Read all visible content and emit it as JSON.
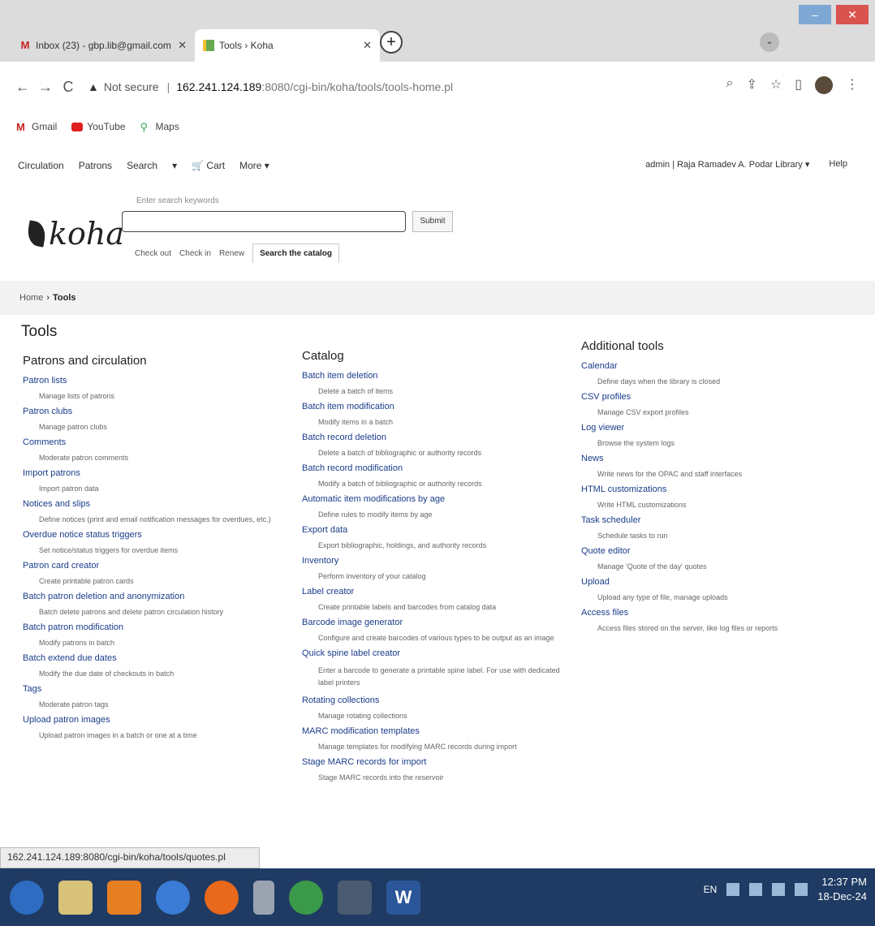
{
  "browser": {
    "tabs": [
      {
        "title": "Inbox (23) - gbp.lib@gmail.com"
      },
      {
        "title": "Tools › Koha"
      }
    ],
    "url": {
      "security": "Not secure",
      "host": "162.241.124.189",
      "path": ":8080/cgi-bin/koha/tools/tools-home.pl"
    },
    "bookmarks": [
      "Gmail",
      "YouTube",
      "Maps"
    ]
  },
  "koha": {
    "nav": [
      "Circulation",
      "Patrons",
      "Search",
      "▾",
      "🛒 Cart",
      "More ▾"
    ],
    "user": "admin | Raja Ramadev A. Podar Library ▾",
    "help": "Help",
    "logo": "koha",
    "search": {
      "hint": "Enter search keywords",
      "placeholder": "",
      "submit": "Submit",
      "tabs": [
        "Check out",
        "Check in",
        "Renew",
        "Search the catalog"
      ]
    },
    "breadcrumb": {
      "home": "Home",
      "current": "Tools"
    },
    "title": "Tools",
    "columns": [
      {
        "heading": "Patrons and circulation",
        "items": [
          {
            "link": "Patron lists",
            "desc": "Manage lists of patrons"
          },
          {
            "link": "Patron clubs",
            "desc": "Manage patron clubs"
          },
          {
            "link": "Comments",
            "desc": "Moderate patron comments"
          },
          {
            "link": "Import patrons",
            "desc": "Import patron data"
          },
          {
            "link": "Notices and slips",
            "desc": "Define notices (print and email notification messages for overdues, etc.)"
          },
          {
            "link": "Overdue notice status triggers",
            "desc": "Set notice/status triggers for overdue items"
          },
          {
            "link": "Patron card creator",
            "desc": "Create printable patron cards"
          },
          {
            "link": "Batch patron deletion and anonymization",
            "desc": "Batch delete patrons and delete patron circulation history"
          },
          {
            "link": "Batch patron modification",
            "desc": "Modify patrons in batch"
          },
          {
            "link": "Batch extend due dates",
            "desc": "Modify the due date of checkouts in batch"
          },
          {
            "link": "Tags",
            "desc": "Moderate patron tags"
          },
          {
            "link": "Upload patron images",
            "desc": "Upload patron images in a batch or one at a time"
          }
        ]
      },
      {
        "heading": "Catalog",
        "items": [
          {
            "link": "Batch item deletion",
            "desc": "Delete a batch of items"
          },
          {
            "link": "Batch item modification",
            "desc": "Modify items in a batch"
          },
          {
            "link": "Batch record deletion",
            "desc": "Delete a batch of bibliographic or authority records"
          },
          {
            "link": "Batch record modification",
            "desc": "Modify a batch of bibliographic or authority records"
          },
          {
            "link": "Automatic item modifications by age",
            "desc": "Define rules to modify items by age"
          },
          {
            "link": "Export data",
            "desc": "Export bibliographic, holdings, and authority records"
          },
          {
            "link": "Inventory",
            "desc": "Perform inventory of your catalog"
          },
          {
            "link": "Label creator",
            "desc": "Create printable labels and barcodes from catalog data"
          },
          {
            "link": "Barcode image generator",
            "desc": "Configure and create barcodes of various types to be output as an image"
          },
          {
            "link": "Quick spine label creator",
            "desc": "Enter a barcode to generate a printable spine label. For use with dedicated label printers"
          },
          {
            "link": "Rotating collections",
            "desc": "Manage rotating collections"
          },
          {
            "link": "MARC modification templates",
            "desc": "Manage templates for modifying MARC records during import"
          },
          {
            "link": "Stage MARC records for import",
            "desc": "Stage MARC records into the reservoir"
          }
        ]
      },
      {
        "heading": "Additional tools",
        "items": [
          {
            "link": "Calendar",
            "desc": "Define days when the library is closed"
          },
          {
            "link": "CSV profiles",
            "desc": "Manage CSV export profiles"
          },
          {
            "link": "Log viewer",
            "desc": "Browse the system logs"
          },
          {
            "link": "News",
            "desc": "Write news for the OPAC and staff interfaces"
          },
          {
            "link": "HTML customizations",
            "desc": "Write HTML customizations"
          },
          {
            "link": "Task scheduler",
            "desc": "Schedule tasks to run"
          },
          {
            "link": "Quote editor",
            "desc": "Manage 'Quote of the day' quotes"
          },
          {
            "link": "Upload",
            "desc": "Upload any type of file, manage uploads"
          },
          {
            "link": "Access files",
            "desc": "Access files stored on the server, like log files or reports"
          }
        ]
      }
    ]
  },
  "status_url": "162.241.124.189:8080/cgi-bin/koha/tools/quotes.pl",
  "taskbar": {
    "lang": "EN",
    "time": "12:37 PM",
    "date": "18-Dec-24",
    "word_label": "W"
  }
}
